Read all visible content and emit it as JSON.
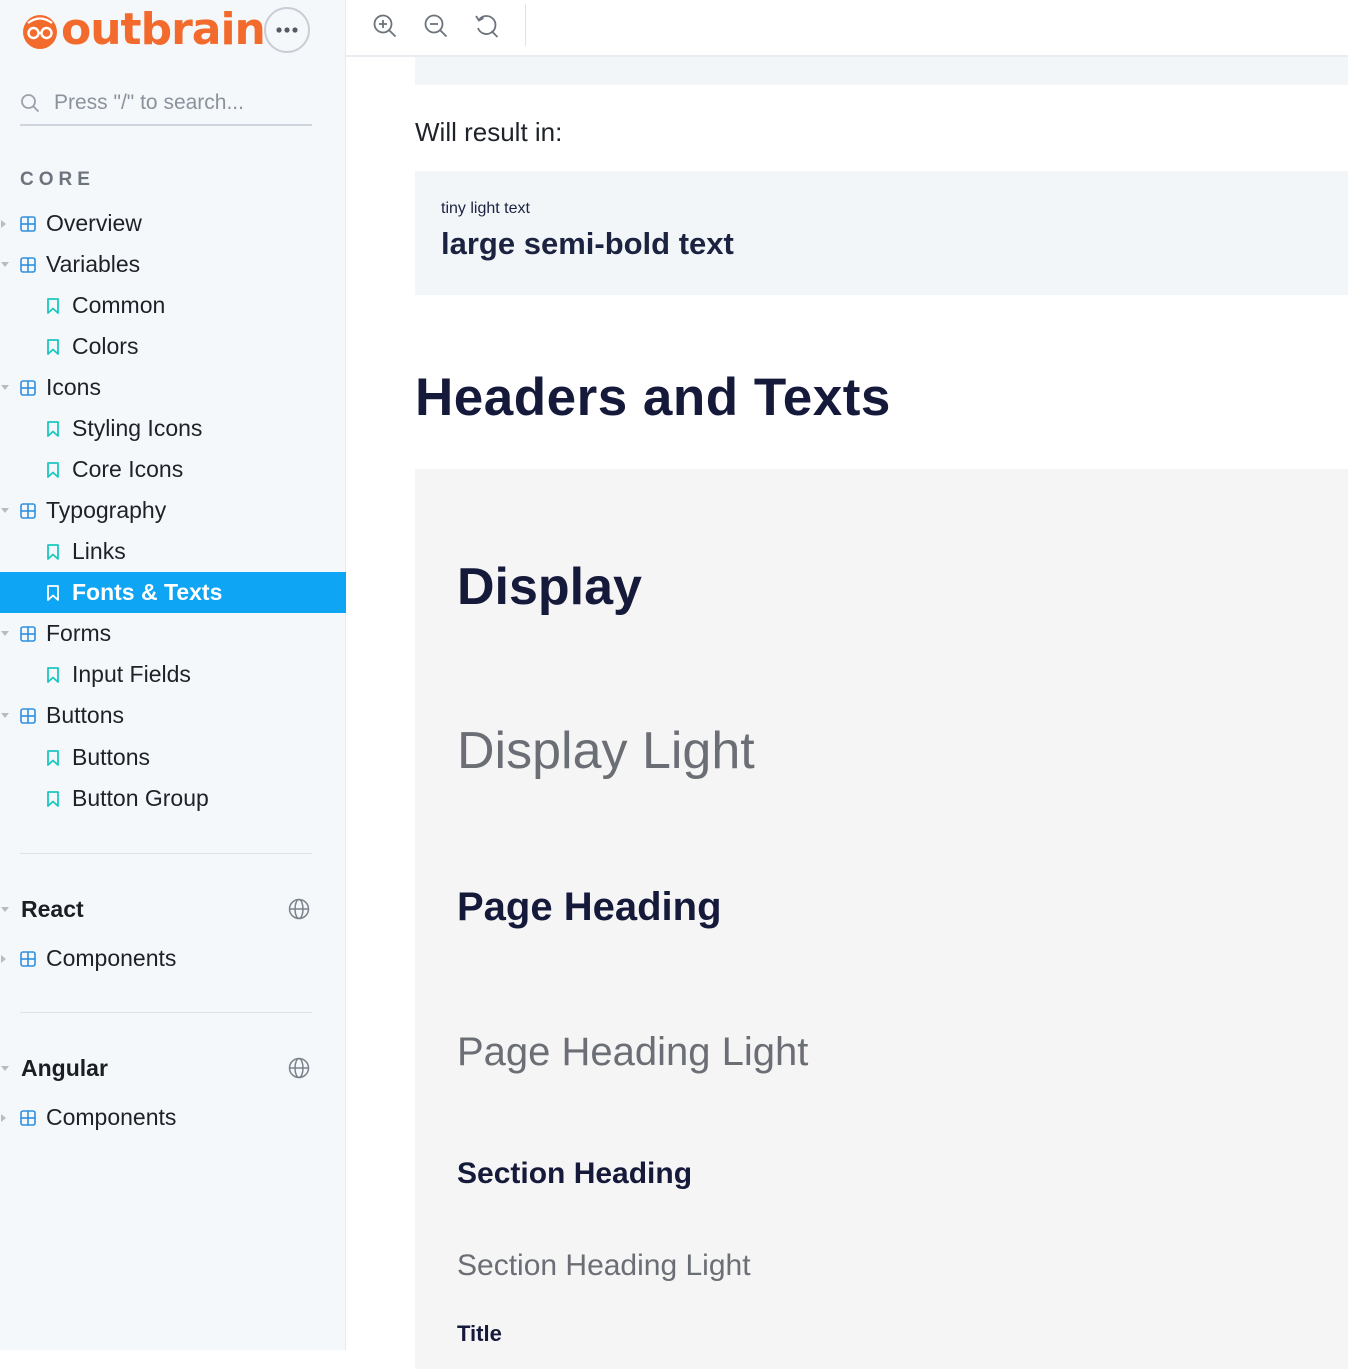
{
  "brand": {
    "name": "outbrain",
    "color": "#f26b2d"
  },
  "search": {
    "placeholder": "Press \"/\" to search..."
  },
  "core": {
    "label": "CORE",
    "items": [
      {
        "label": "Overview",
        "level": 1,
        "icon": "grid-icon"
      },
      {
        "label": "Variables",
        "level": 1,
        "icon": "grid-icon"
      },
      {
        "label": "Common",
        "level": 2,
        "icon": "bookmark-icon"
      },
      {
        "label": "Colors",
        "level": 2,
        "icon": "bookmark-icon"
      },
      {
        "label": "Icons",
        "level": 1,
        "icon": "grid-icon"
      },
      {
        "label": "Styling Icons",
        "level": 2,
        "icon": "bookmark-icon"
      },
      {
        "label": "Core Icons",
        "level": 2,
        "icon": "bookmark-icon"
      },
      {
        "label": "Typography",
        "level": 1,
        "icon": "grid-icon"
      },
      {
        "label": "Links",
        "level": 2,
        "icon": "bookmark-icon"
      },
      {
        "label": "Fonts & Texts",
        "level": 2,
        "icon": "bookmark-icon",
        "active": true
      },
      {
        "label": "Forms",
        "level": 1,
        "icon": "grid-icon"
      },
      {
        "label": "Input Fields",
        "level": 2,
        "icon": "bookmark-icon"
      },
      {
        "label": "Buttons",
        "level": 1,
        "icon": "grid-icon"
      },
      {
        "label": "Buttons",
        "level": 2,
        "icon": "bookmark-icon"
      },
      {
        "label": "Button Group",
        "level": 2,
        "icon": "bookmark-icon"
      }
    ]
  },
  "react": {
    "title": "React",
    "items": [
      {
        "label": "Components"
      }
    ]
  },
  "angular": {
    "title": "Angular",
    "items": [
      {
        "label": "Components"
      }
    ]
  },
  "main": {
    "result_label": "Will result in:",
    "example": {
      "tiny": "tiny light text",
      "large": "large semi-bold text"
    },
    "section_heading": "Headers and Texts",
    "samples": [
      {
        "text": "Display",
        "style": "dark"
      },
      {
        "text": "Display Light",
        "style": "light"
      },
      {
        "text": "Page Heading",
        "style": "dark"
      },
      {
        "text": "Page Heading Light",
        "style": "light"
      },
      {
        "text": "Section Heading",
        "style": "dark"
      },
      {
        "text": "Section Heading Light",
        "style": "light"
      },
      {
        "text": "Title",
        "style": "dark"
      }
    ]
  },
  "colors": {
    "accent": "#0ea5f4",
    "icon_teal": "#1cc7c0",
    "grid_blue": "#2f8fe0"
  }
}
